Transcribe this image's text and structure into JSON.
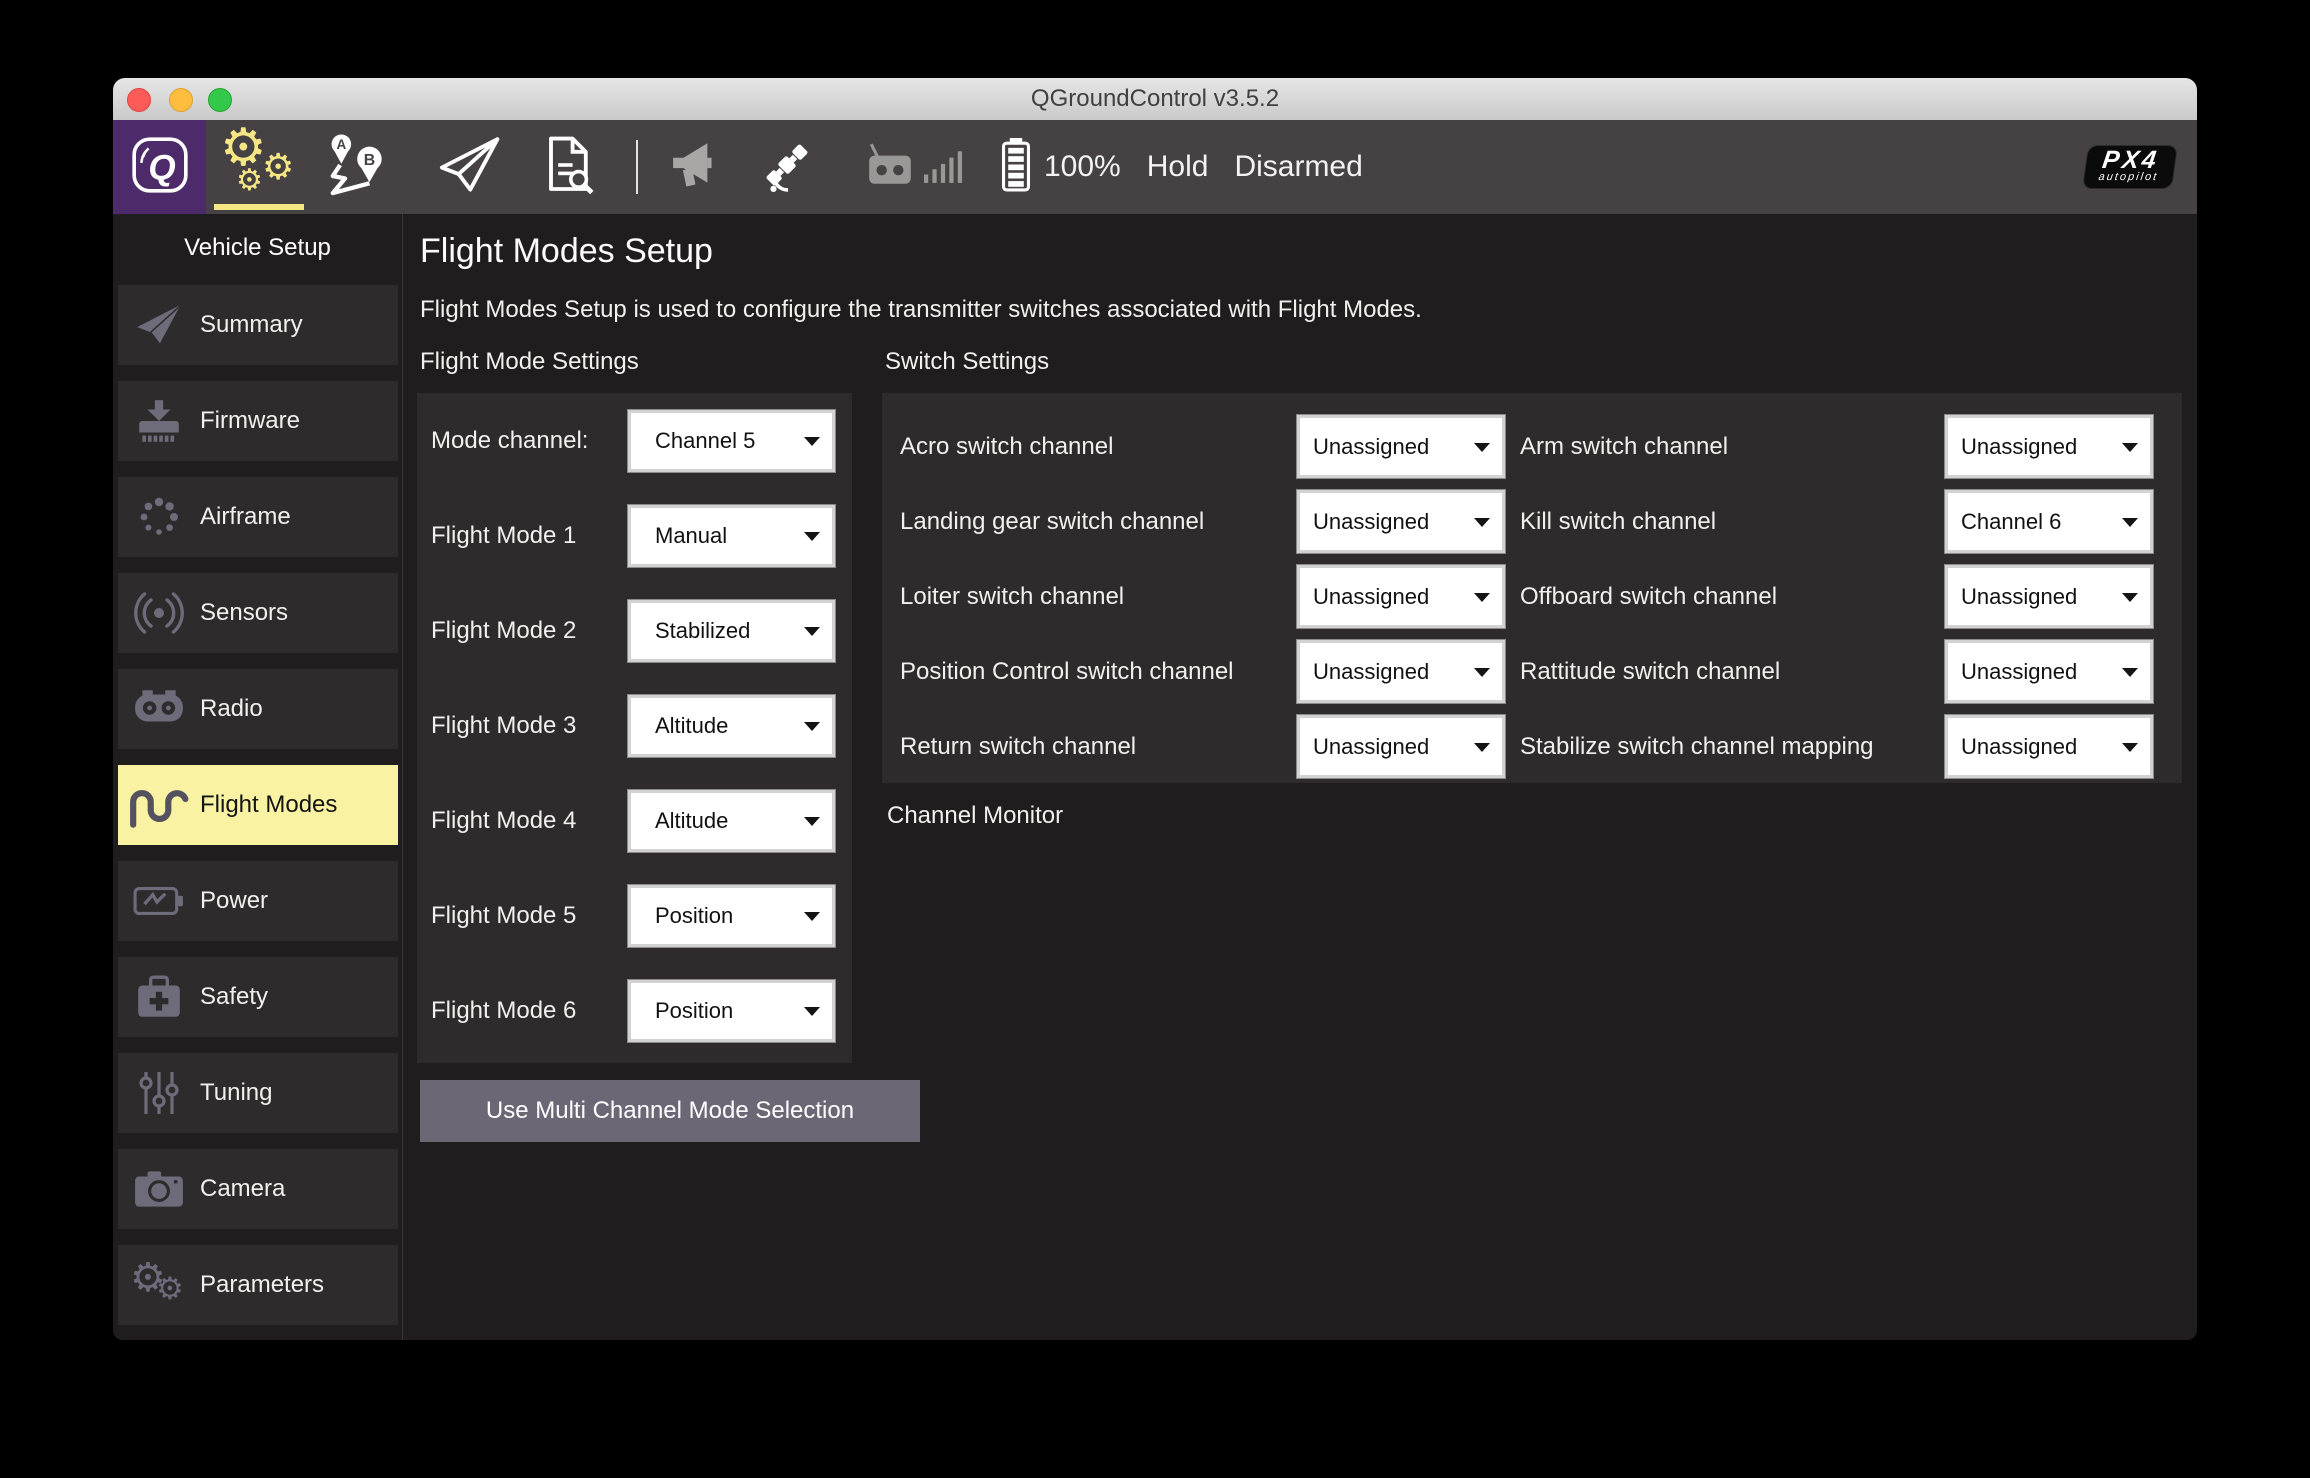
{
  "window": {
    "title": "QGroundControl v3.5.2"
  },
  "toolbar": {
    "views": [
      {
        "key": "home",
        "icon": "qgc-logo-icon",
        "active": false
      },
      {
        "key": "settings",
        "icon": "settings-gears-icon",
        "active": true
      },
      {
        "key": "plan",
        "icon": "plan-waypoints-icon",
        "active": false
      },
      {
        "key": "fly",
        "icon": "fly-paper-plane-icon",
        "active": false
      },
      {
        "key": "analyze",
        "icon": "analyze-document-icon",
        "active": false
      }
    ],
    "status": {
      "battery_percent": "100%",
      "flight_mode": "Hold",
      "armed_state": "Disarmed"
    },
    "px4_logo": {
      "title": "PX4",
      "subtitle": "autopilot"
    }
  },
  "sidebar": {
    "header": "Vehicle Setup",
    "items": [
      {
        "key": "summary",
        "label": "Summary",
        "icon": "paper-plane-icon",
        "active": false
      },
      {
        "key": "firmware",
        "label": "Firmware",
        "icon": "firmware-download-icon",
        "active": false
      },
      {
        "key": "airframe",
        "label": "Airframe",
        "icon": "airframe-spinner-icon",
        "active": false
      },
      {
        "key": "sensors",
        "label": "Sensors",
        "icon": "sensors-signal-icon",
        "active": false
      },
      {
        "key": "radio",
        "label": "Radio",
        "icon": "radio-remote-icon",
        "active": false
      },
      {
        "key": "flight-modes",
        "label": "Flight Modes",
        "icon": "flight-modes-wave-icon",
        "active": true
      },
      {
        "key": "power",
        "label": "Power",
        "icon": "power-battery-icon",
        "active": false
      },
      {
        "key": "safety",
        "label": "Safety",
        "icon": "safety-kit-icon",
        "active": false
      },
      {
        "key": "tuning",
        "label": "Tuning",
        "icon": "tuning-sliders-icon",
        "active": false
      },
      {
        "key": "camera",
        "label": "Camera",
        "icon": "camera-icon",
        "active": false
      },
      {
        "key": "parameters",
        "label": "Parameters",
        "icon": "parameters-gears-icon",
        "active": false
      }
    ]
  },
  "main": {
    "title": "Flight Modes Setup",
    "subtitle": "Flight Modes Setup is used to configure the transmitter switches associated with Flight Modes.",
    "channel_monitor": "Channel Monitor",
    "flight_mode_settings": {
      "heading": "Flight Mode Settings",
      "button_label": "Use Multi Channel Mode Selection",
      "rows": [
        {
          "key": "mode-channel",
          "label": "Mode channel:",
          "value": "Channel 5"
        },
        {
          "key": "flight-mode-1",
          "label": "Flight Mode 1",
          "value": "Manual"
        },
        {
          "key": "flight-mode-2",
          "label": "Flight Mode 2",
          "value": "Stabilized"
        },
        {
          "key": "flight-mode-3",
          "label": "Flight Mode 3",
          "value": "Altitude"
        },
        {
          "key": "flight-mode-4",
          "label": "Flight Mode 4",
          "value": "Altitude"
        },
        {
          "key": "flight-mode-5",
          "label": "Flight Mode 5",
          "value": "Position"
        },
        {
          "key": "flight-mode-6",
          "label": "Flight Mode 6",
          "value": "Position"
        }
      ]
    },
    "switch_settings": {
      "heading": "Switch Settings",
      "left_rows": [
        {
          "key": "acro-switch",
          "label": "Acro switch channel",
          "value": "Unassigned"
        },
        {
          "key": "landing-gear-switch",
          "label": "Landing gear switch channel",
          "value": "Unassigned"
        },
        {
          "key": "loiter-switch",
          "label": "Loiter switch channel",
          "value": "Unassigned"
        },
        {
          "key": "position-control-switch",
          "label": "Position Control switch channel",
          "value": "Unassigned"
        },
        {
          "key": "return-switch",
          "label": "Return switch channel",
          "value": "Unassigned"
        }
      ],
      "right_rows": [
        {
          "key": "arm-switch",
          "label": "Arm switch channel",
          "value": "Unassigned"
        },
        {
          "key": "kill-switch",
          "label": "Kill switch channel",
          "value": "Channel 6"
        },
        {
          "key": "offboard-switch",
          "label": "Offboard switch channel",
          "value": "Unassigned"
        },
        {
          "key": "rattitude-switch",
          "label": "Rattitude switch channel",
          "value": "Unassigned"
        },
        {
          "key": "stabilize-switch",
          "label": "Stabilize switch channel mapping",
          "value": "Unassigned"
        }
      ]
    }
  },
  "colors": {
    "accent_yellow": "#f6e784",
    "active_highlight": "#f8f2a2",
    "brand_purple": "#4d2a6a",
    "toolbar_gray": "#464243",
    "panel_gray": "#2e2b2c",
    "button_purple_gray": "#6b6775"
  }
}
